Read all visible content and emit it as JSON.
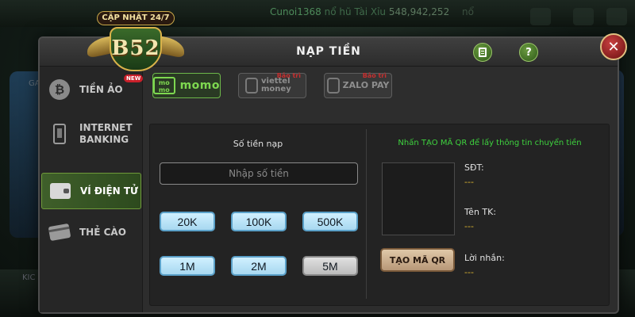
{
  "background": {
    "ticker_user": "Cunoi1368",
    "ticker_text": "nổ hũ Tài Xỉu",
    "ticker_amount": "548,942,252",
    "ticker_tail": "nổ",
    "left_tag": "KIC",
    "right_tag": "ỆN",
    "right_badge": "621",
    "left_ga": "GA"
  },
  "logo": {
    "update_label": "CẬP NHẬT 24/7",
    "brand": "B52"
  },
  "modal": {
    "title": "NẠP TIỀN",
    "help_label": "?",
    "close_label": "✕"
  },
  "sidebar": {
    "items": [
      {
        "label": "TIỀN ẢO",
        "icon": "bitcoin-icon",
        "badge": "NEW"
      },
      {
        "label": "INTERNET BANKING",
        "icon": "phone-bank-icon"
      },
      {
        "label": "VÍ ĐIỆN TỬ",
        "icon": "wallet-icon",
        "active": true
      },
      {
        "label": "THẺ CÀO",
        "icon": "card-icon"
      }
    ]
  },
  "providers": [
    {
      "label": "momo",
      "mark": "mo mo",
      "status": ""
    },
    {
      "label": "viettel money",
      "status": "Bảo trì"
    },
    {
      "label": "ZALO PAY",
      "status": "Bảo trì"
    }
  ],
  "deposit": {
    "amount_label": "Số tiền nạp",
    "placeholder": "Nhập số tiền",
    "amounts": [
      "20K",
      "100K",
      "500K",
      "1M",
      "2M",
      "5M"
    ]
  },
  "qr": {
    "hint": "Nhấn TẠO MÃ QR để lấy thông tin chuyển tiền",
    "button_label": "TẠO MÃ QR",
    "phone_label": "SĐT:",
    "phone_value": "---",
    "account_label": "Tên TK:",
    "account_value": "---",
    "message_label": "Lời nhắn:",
    "message_value": "---"
  },
  "colors": {
    "accent_green": "#3ed23e",
    "momo_green": "#7ed850",
    "maintenance_red": "#e03030",
    "value_gold": "#e0b830"
  }
}
